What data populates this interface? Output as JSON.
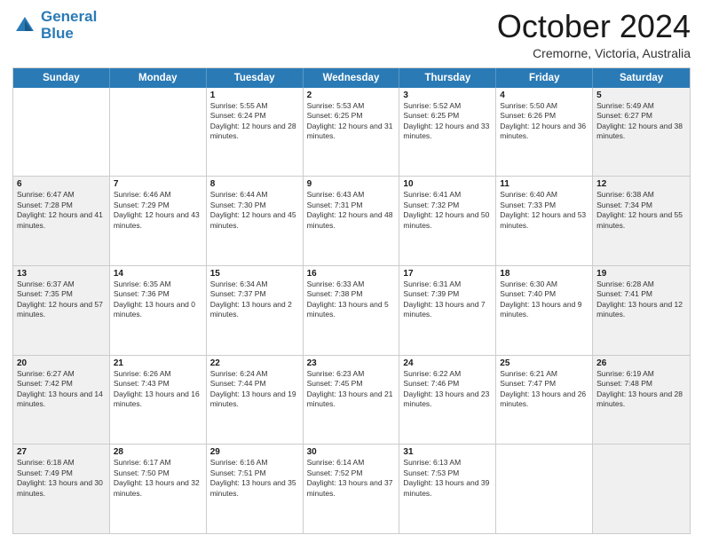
{
  "header": {
    "logo_line1": "General",
    "logo_line2": "Blue",
    "month_title": "October 2024",
    "location": "Cremorne, Victoria, Australia"
  },
  "weekdays": [
    "Sunday",
    "Monday",
    "Tuesday",
    "Wednesday",
    "Thursday",
    "Friday",
    "Saturday"
  ],
  "rows": [
    [
      {
        "day": "",
        "text": "",
        "shaded": false
      },
      {
        "day": "",
        "text": "",
        "shaded": false
      },
      {
        "day": "1",
        "text": "Sunrise: 5:55 AM\nSunset: 6:24 PM\nDaylight: 12 hours and 28 minutes.",
        "shaded": false
      },
      {
        "day": "2",
        "text": "Sunrise: 5:53 AM\nSunset: 6:25 PM\nDaylight: 12 hours and 31 minutes.",
        "shaded": false
      },
      {
        "day": "3",
        "text": "Sunrise: 5:52 AM\nSunset: 6:25 PM\nDaylight: 12 hours and 33 minutes.",
        "shaded": false
      },
      {
        "day": "4",
        "text": "Sunrise: 5:50 AM\nSunset: 6:26 PM\nDaylight: 12 hours and 36 minutes.",
        "shaded": false
      },
      {
        "day": "5",
        "text": "Sunrise: 5:49 AM\nSunset: 6:27 PM\nDaylight: 12 hours and 38 minutes.",
        "shaded": true
      }
    ],
    [
      {
        "day": "6",
        "text": "Sunrise: 6:47 AM\nSunset: 7:28 PM\nDaylight: 12 hours and 41 minutes.",
        "shaded": true
      },
      {
        "day": "7",
        "text": "Sunrise: 6:46 AM\nSunset: 7:29 PM\nDaylight: 12 hours and 43 minutes.",
        "shaded": false
      },
      {
        "day": "8",
        "text": "Sunrise: 6:44 AM\nSunset: 7:30 PM\nDaylight: 12 hours and 45 minutes.",
        "shaded": false
      },
      {
        "day": "9",
        "text": "Sunrise: 6:43 AM\nSunset: 7:31 PM\nDaylight: 12 hours and 48 minutes.",
        "shaded": false
      },
      {
        "day": "10",
        "text": "Sunrise: 6:41 AM\nSunset: 7:32 PM\nDaylight: 12 hours and 50 minutes.",
        "shaded": false
      },
      {
        "day": "11",
        "text": "Sunrise: 6:40 AM\nSunset: 7:33 PM\nDaylight: 12 hours and 53 minutes.",
        "shaded": false
      },
      {
        "day": "12",
        "text": "Sunrise: 6:38 AM\nSunset: 7:34 PM\nDaylight: 12 hours and 55 minutes.",
        "shaded": true
      }
    ],
    [
      {
        "day": "13",
        "text": "Sunrise: 6:37 AM\nSunset: 7:35 PM\nDaylight: 12 hours and 57 minutes.",
        "shaded": true
      },
      {
        "day": "14",
        "text": "Sunrise: 6:35 AM\nSunset: 7:36 PM\nDaylight: 13 hours and 0 minutes.",
        "shaded": false
      },
      {
        "day": "15",
        "text": "Sunrise: 6:34 AM\nSunset: 7:37 PM\nDaylight: 13 hours and 2 minutes.",
        "shaded": false
      },
      {
        "day": "16",
        "text": "Sunrise: 6:33 AM\nSunset: 7:38 PM\nDaylight: 13 hours and 5 minutes.",
        "shaded": false
      },
      {
        "day": "17",
        "text": "Sunrise: 6:31 AM\nSunset: 7:39 PM\nDaylight: 13 hours and 7 minutes.",
        "shaded": false
      },
      {
        "day": "18",
        "text": "Sunrise: 6:30 AM\nSunset: 7:40 PM\nDaylight: 13 hours and 9 minutes.",
        "shaded": false
      },
      {
        "day": "19",
        "text": "Sunrise: 6:28 AM\nSunset: 7:41 PM\nDaylight: 13 hours and 12 minutes.",
        "shaded": true
      }
    ],
    [
      {
        "day": "20",
        "text": "Sunrise: 6:27 AM\nSunset: 7:42 PM\nDaylight: 13 hours and 14 minutes.",
        "shaded": true
      },
      {
        "day": "21",
        "text": "Sunrise: 6:26 AM\nSunset: 7:43 PM\nDaylight: 13 hours and 16 minutes.",
        "shaded": false
      },
      {
        "day": "22",
        "text": "Sunrise: 6:24 AM\nSunset: 7:44 PM\nDaylight: 13 hours and 19 minutes.",
        "shaded": false
      },
      {
        "day": "23",
        "text": "Sunrise: 6:23 AM\nSunset: 7:45 PM\nDaylight: 13 hours and 21 minutes.",
        "shaded": false
      },
      {
        "day": "24",
        "text": "Sunrise: 6:22 AM\nSunset: 7:46 PM\nDaylight: 13 hours and 23 minutes.",
        "shaded": false
      },
      {
        "day": "25",
        "text": "Sunrise: 6:21 AM\nSunset: 7:47 PM\nDaylight: 13 hours and 26 minutes.",
        "shaded": false
      },
      {
        "day": "26",
        "text": "Sunrise: 6:19 AM\nSunset: 7:48 PM\nDaylight: 13 hours and 28 minutes.",
        "shaded": true
      }
    ],
    [
      {
        "day": "27",
        "text": "Sunrise: 6:18 AM\nSunset: 7:49 PM\nDaylight: 13 hours and 30 minutes.",
        "shaded": true
      },
      {
        "day": "28",
        "text": "Sunrise: 6:17 AM\nSunset: 7:50 PM\nDaylight: 13 hours and 32 minutes.",
        "shaded": false
      },
      {
        "day": "29",
        "text": "Sunrise: 6:16 AM\nSunset: 7:51 PM\nDaylight: 13 hours and 35 minutes.",
        "shaded": false
      },
      {
        "day": "30",
        "text": "Sunrise: 6:14 AM\nSunset: 7:52 PM\nDaylight: 13 hours and 37 minutes.",
        "shaded": false
      },
      {
        "day": "31",
        "text": "Sunrise: 6:13 AM\nSunset: 7:53 PM\nDaylight: 13 hours and 39 minutes.",
        "shaded": false
      },
      {
        "day": "",
        "text": "",
        "shaded": false
      },
      {
        "day": "",
        "text": "",
        "shaded": true
      }
    ]
  ]
}
